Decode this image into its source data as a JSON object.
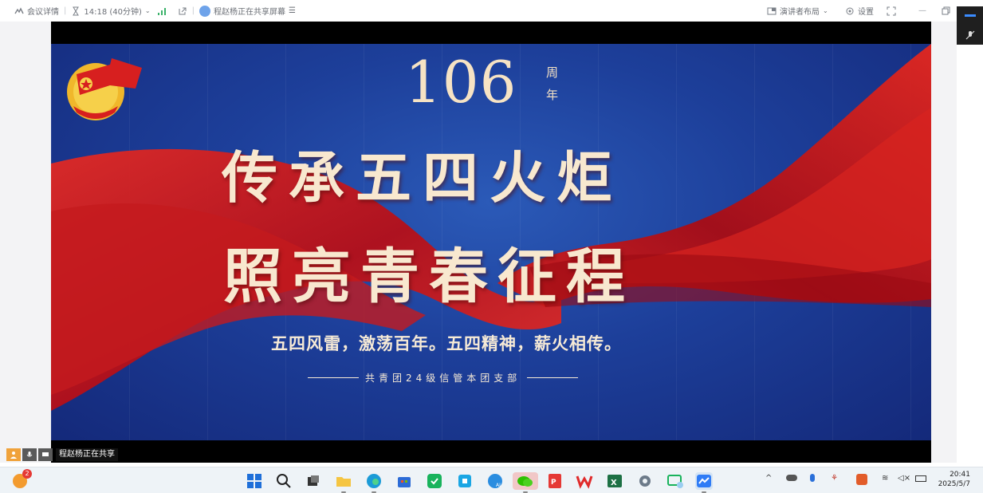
{
  "topbar": {
    "meeting_details": "会议详情",
    "duration": "14:18 (40分钟)",
    "sharing_status": "程赵杨正在共享屏幕",
    "presenter_layout": "演讲者布局",
    "settings": "设置"
  },
  "slide": {
    "year_number": "106",
    "year_suffix_1": "周",
    "year_suffix_2": "年",
    "headline_1": "传承五四火炬",
    "headline_2": "照亮青春征程",
    "subtitle": "五四风雷，激荡百年。五四精神，薪火相传。",
    "signature": "共青团24级信管本团支部",
    "emblem_text": "中国共青团"
  },
  "sharebar": {
    "sharing_label": "程赵杨正在共享"
  },
  "taskbar": {
    "chat_badge": "2",
    "time": "20:41",
    "date": "2025/5/7"
  },
  "colors": {
    "slide_blue": "#1d3f9a",
    "ribbon_red": "#c8141c",
    "gold_text": "#f6e3c4",
    "accent_orange": "#f0a23b"
  }
}
